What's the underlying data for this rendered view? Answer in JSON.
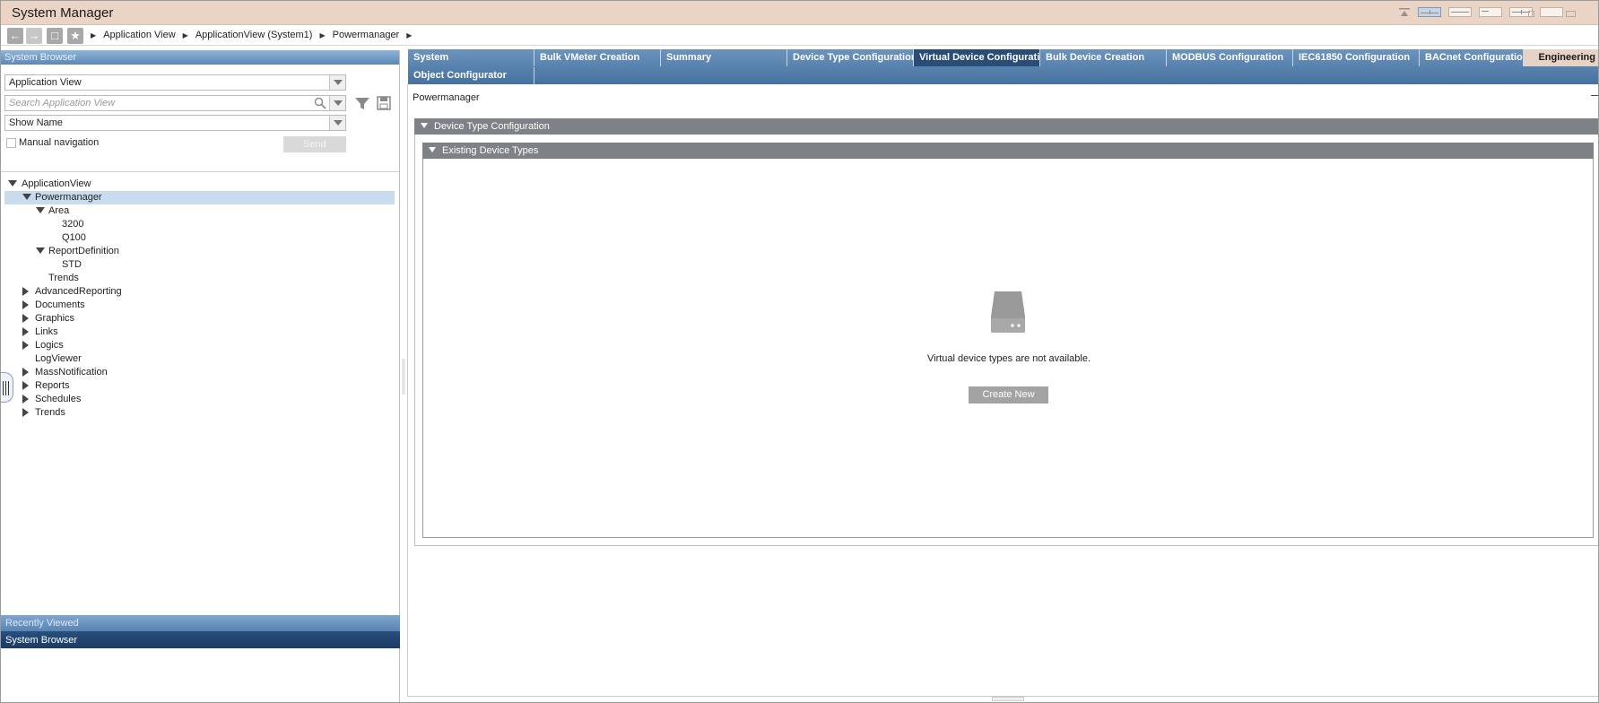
{
  "app": {
    "title": "System Manager"
  },
  "titlebar": {
    "layout_icons": [
      "layout-1-icon",
      "layout-2-icon",
      "layout-3-icon",
      "layout-4-icon",
      "layout-5-icon",
      "layout-6-icon"
    ]
  },
  "nav": {
    "back_icon": "back-arrow-icon",
    "forward_icon": "forward-arrow-icon",
    "home_icon": "monitor-icon",
    "favorites_icon": "star-icon",
    "breadcrumb": [
      "Application View",
      "ApplicationView (System1)",
      "Powermanager"
    ]
  },
  "left": {
    "header": "System Browser",
    "view_select": "Application View",
    "search": {
      "placeholder": "Search Application View"
    },
    "display_select": "Show Name",
    "manual_navigation": "Manual navigation",
    "send": "Send",
    "tree": [
      {
        "label": "ApplicationView"
      },
      {
        "label": "Powermanager"
      },
      {
        "label": "Area"
      },
      {
        "label": "3200"
      },
      {
        "label": "Q100"
      },
      {
        "label": "ReportDefinition"
      },
      {
        "label": "STD"
      },
      {
        "label": "Trends"
      },
      {
        "label": "AdvancedReporting"
      },
      {
        "label": "Documents"
      },
      {
        "label": "Graphics"
      },
      {
        "label": "Links"
      },
      {
        "label": "Logics"
      },
      {
        "label": "LogViewer"
      },
      {
        "label": "MassNotification"
      },
      {
        "label": "Reports"
      },
      {
        "label": "Schedules"
      },
      {
        "label": "Trends"
      }
    ],
    "recently_viewed": "Recently Viewed",
    "bottom_tab": "System Browser"
  },
  "tabs": [
    "System",
    "Bulk VMeter Creation",
    "Summary",
    "Device Type Configuration",
    "Virtual Device Configuratio",
    "Bulk Device Creation",
    "MODBUS Configuration",
    "IEC61850 Configuration",
    "BACnet Configuration",
    "Engineering",
    "Object Configurator"
  ],
  "main": {
    "page_title": "Powermanager",
    "section_title": "Device Type Configuration",
    "subsection_title": "Existing Device Types",
    "empty_message": "Virtual device types are not available.",
    "create_new": "Create New",
    "empty_icon": "hard-drive-icon"
  }
}
